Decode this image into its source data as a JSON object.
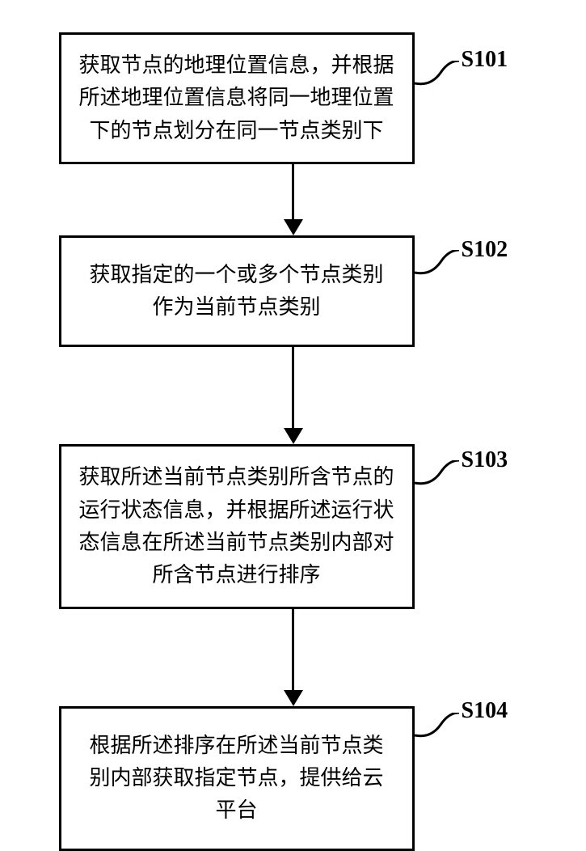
{
  "steps": [
    {
      "label": "S101",
      "text": "获取节点的地理位置信息，并根据所述地理位置信息将同一地理位置下的节点划分在同一节点类别下"
    },
    {
      "label": "S102",
      "text": "获取指定的一个或多个节点类别作为当前节点类别"
    },
    {
      "label": "S103",
      "text": "获取所述当前节点类别所含节点的运行状态信息，并根据所述运行状态信息在所述当前节点类别内部对所含节点进行排序"
    },
    {
      "label": "S104",
      "text": "根据所述排序在所述当前节点类别内部获取指定节点，提供给云平台"
    }
  ]
}
